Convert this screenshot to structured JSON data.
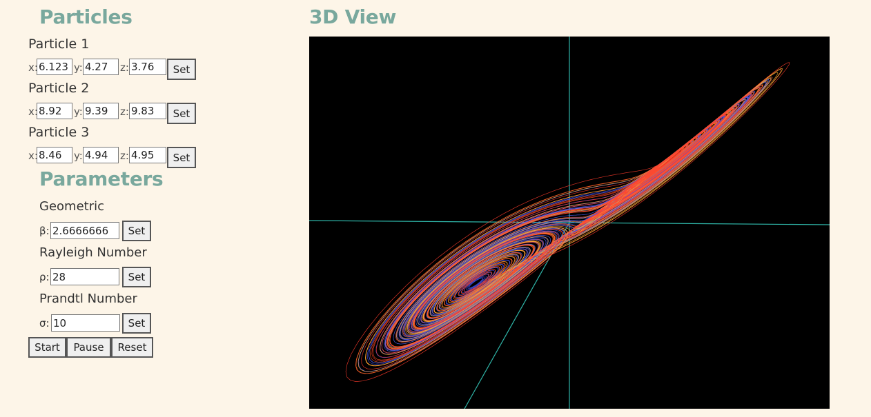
{
  "particles": {
    "heading": "Particles",
    "items": [
      {
        "label": "Particle 1",
        "x": "6.123",
        "y": "4.27",
        "z": "3.76"
      },
      {
        "label": "Particle 2",
        "x": "8.92",
        "y": "9.39",
        "z": "9.83"
      },
      {
        "label": "Particle 3",
        "x": "8.46",
        "y": "4.94",
        "z": "4.95"
      }
    ],
    "x_label": "x:",
    "y_label": "y:",
    "z_label": "z:",
    "set_label": "Set"
  },
  "parameters": {
    "heading": "Parameters",
    "geometric": {
      "title": "Geometric",
      "symbol": "β:",
      "value": "2.6666666"
    },
    "rayleigh": {
      "title": "Rayleigh Number",
      "symbol": "ρ:",
      "value": "28"
    },
    "prandtl": {
      "title": "Prandtl Number",
      "symbol": "σ:",
      "value": "10"
    },
    "set_label": "Set"
  },
  "controls": {
    "start": "Start",
    "pause": "Pause",
    "reset": "Reset"
  },
  "view": {
    "heading": "3D View",
    "background": "#000000",
    "axis_color": "#2fb5a8",
    "trajectory_colors": [
      "#ff7a33",
      "#ff5522",
      "#5566ff",
      "#3f4fe0",
      "#ffaa33",
      "#ff3b2b"
    ]
  }
}
